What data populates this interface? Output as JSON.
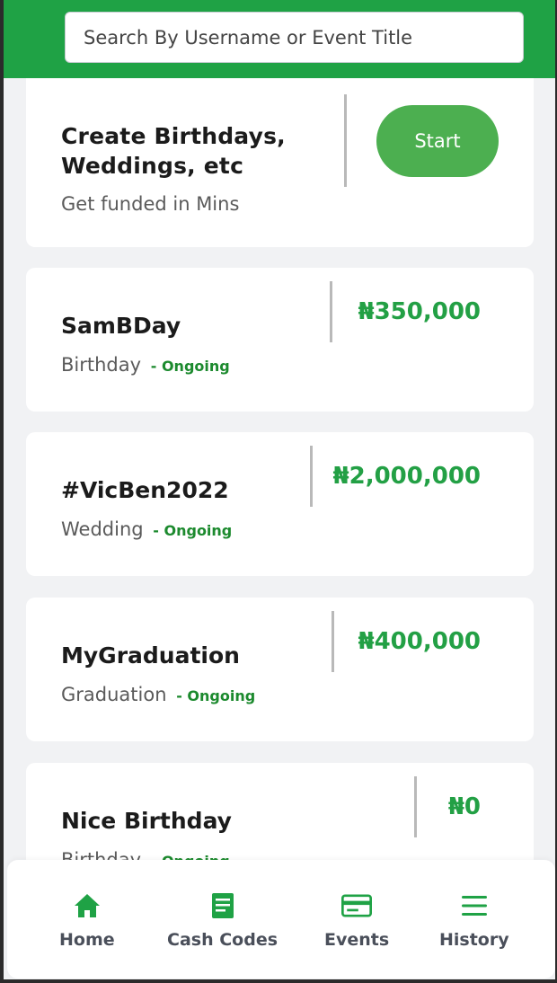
{
  "search": {
    "placeholder": "Search By Username or Event Title",
    "value": ""
  },
  "promo": {
    "title": "Create Birthdays, Weddings, etc",
    "subtitle": "Get funded in Mins",
    "button_label": "Start"
  },
  "events": [
    {
      "title": "SamBDay",
      "category": "Birthday",
      "status": "- Ongoing",
      "amount": "₦350,000"
    },
    {
      "title": "#VicBen2022",
      "category": "Wedding",
      "status": "- Ongoing",
      "amount": "₦2,000,000"
    },
    {
      "title": "MyGraduation",
      "category": "Graduation",
      "status": "- Ongoing",
      "amount": "₦400,000"
    },
    {
      "title": "Nice Birthday",
      "category": "Birthday",
      "status": "- Ongoing",
      "amount": "₦0"
    }
  ],
  "nav": [
    {
      "label": "Home",
      "icon": "home-icon"
    },
    {
      "label": "Cash Codes",
      "icon": "document-icon"
    },
    {
      "label": "Events",
      "icon": "card-icon"
    },
    {
      "label": "History",
      "icon": "menu-icon"
    }
  ],
  "colors": {
    "header_green": "#1fa245",
    "button_green": "#4caf50",
    "amount_green": "#23a045",
    "status_green": "#1c8a2e",
    "nav_green": "#1fa245"
  }
}
